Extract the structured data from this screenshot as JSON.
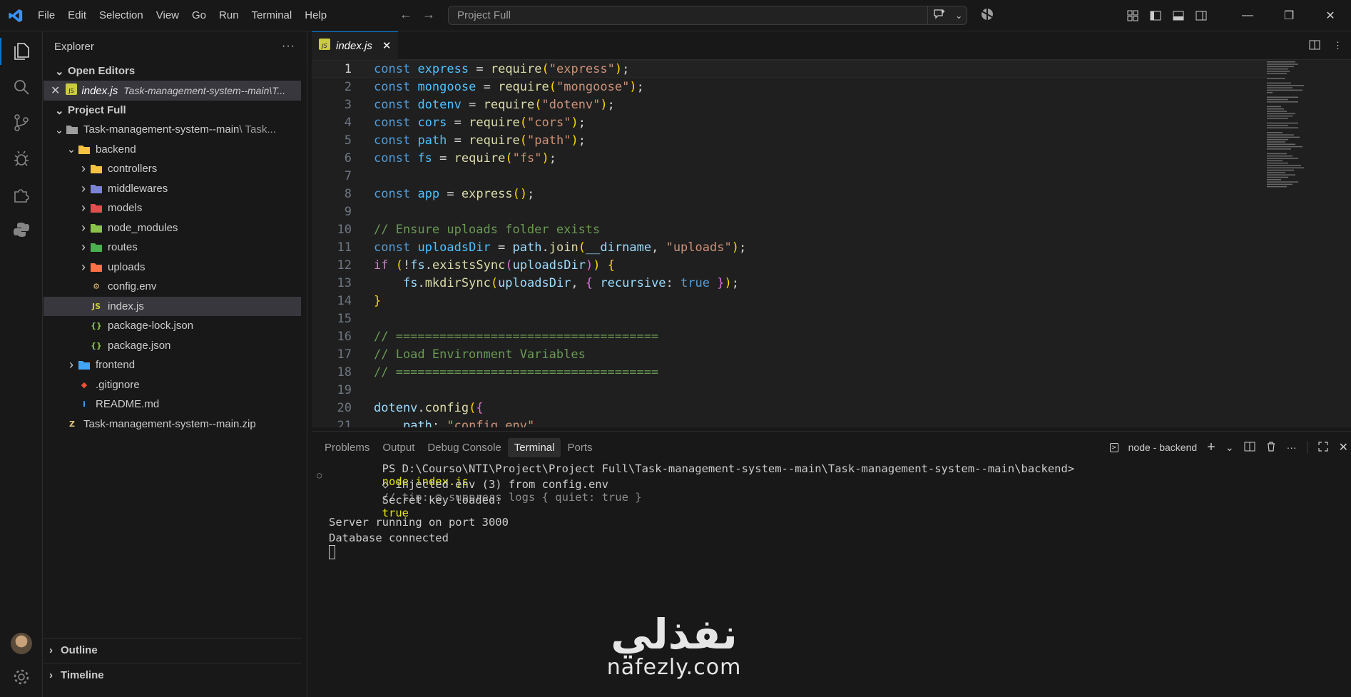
{
  "titlebar": {
    "menu": [
      "File",
      "Edit",
      "Selection",
      "View",
      "Go",
      "Run",
      "Terminal",
      "Help"
    ],
    "search_placeholder": "Project Full"
  },
  "sidebar": {
    "title": "Explorer",
    "open_editors_label": "Open Editors",
    "open_editor": {
      "name": "index.js",
      "desc": "Task-management-system--main\\T..."
    },
    "project_label": "Project Full",
    "tree": [
      {
        "label": "Task-management-system--main",
        "desc": "\\ Task...",
        "depth": 0,
        "type": "folder-open"
      },
      {
        "label": "backend",
        "depth": 1,
        "type": "folder-open"
      },
      {
        "label": "controllers",
        "depth": 2,
        "type": "folder"
      },
      {
        "label": "middlewares",
        "depth": 2,
        "type": "folder"
      },
      {
        "label": "models",
        "depth": 2,
        "type": "folder"
      },
      {
        "label": "node_modules",
        "depth": 2,
        "type": "folder"
      },
      {
        "label": "routes",
        "depth": 2,
        "type": "folder"
      },
      {
        "label": "uploads",
        "depth": 2,
        "type": "folder"
      },
      {
        "label": "config.env",
        "depth": 2,
        "type": "file"
      },
      {
        "label": "index.js",
        "depth": 2,
        "type": "file",
        "selected": true
      },
      {
        "label": "package-lock.json",
        "depth": 2,
        "type": "file"
      },
      {
        "label": "package.json",
        "depth": 2,
        "type": "file"
      },
      {
        "label": "frontend",
        "depth": 1,
        "type": "folder"
      },
      {
        "label": ".gitignore",
        "depth": 1,
        "type": "file"
      },
      {
        "label": "README.md",
        "depth": 1,
        "type": "file"
      },
      {
        "label": "Task-management-system--main.zip",
        "depth": 0,
        "type": "file"
      }
    ],
    "outline_label": "Outline",
    "timeline_label": "Timeline"
  },
  "editor": {
    "tab_label": "index.js",
    "lines": [
      "const express = require(\"express\");",
      "const mongoose = require(\"mongoose\");",
      "const dotenv = require(\"dotenv\");",
      "const cors = require(\"cors\");",
      "const path = require(\"path\");",
      "const fs = require(\"fs\");",
      "",
      "const app = express();",
      "",
      "// Ensure uploads folder exists",
      "const uploadsDir = path.join(__dirname, \"uploads\");",
      "if (!fs.existsSync(uploadsDir)) {",
      "    fs.mkdirSync(uploadsDir, { recursive: true });",
      "}",
      "",
      "// ====================================",
      "// Load Environment Variables",
      "// ====================================",
      "",
      "dotenv.config({",
      "    path: \"config.env\""
    ]
  },
  "panel": {
    "tabs": [
      "Problems",
      "Output",
      "Debug Console",
      "Terminal",
      "Ports"
    ],
    "active_tab": "Terminal",
    "terminal_name": "node - backend",
    "terminal": {
      "prompt": "PS D:\\Courso\\NTI\\Project\\Project Full\\Task-management-system--main\\Task-management-system--main\\backend>",
      "command": "node index.js",
      "line2_a": "◇ injected env (3) from config.env",
      "line2_b": "// tip: ⚙ suppress logs { quiet: true }",
      "line3_a": "Secret key loaded:",
      "line3_b": "true",
      "line4": "Server running on port 3000",
      "line5": "Database connected"
    }
  },
  "watermark": {
    "arabic": "نفذلي",
    "latin": "nafezly.com"
  },
  "colors": {
    "accent": "#0078d4",
    "background": "#181818",
    "editor_bg": "#1f1f1f"
  }
}
